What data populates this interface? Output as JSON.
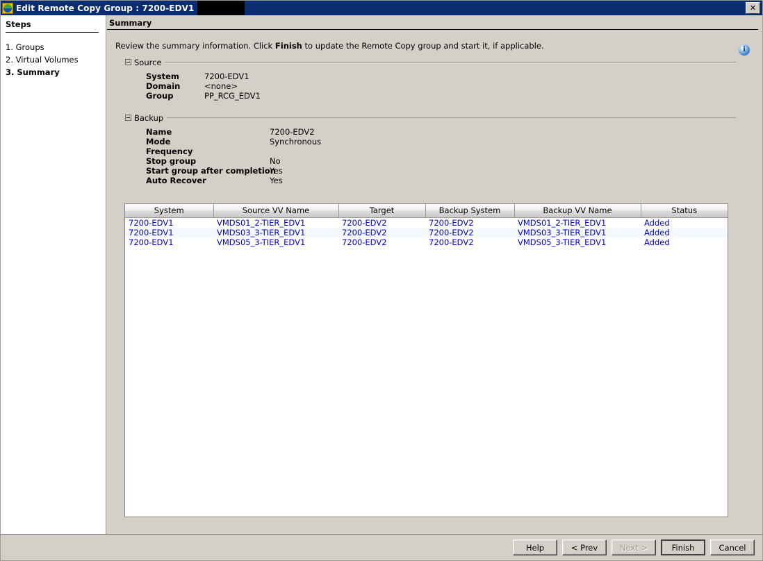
{
  "window": {
    "title": "Edit Remote Copy Group : 7200-EDV1",
    "icon": "app-globe-icon",
    "close_label": "✕",
    "redacted": true
  },
  "sidebar": {
    "title": "Steps",
    "items": [
      {
        "label": "1. Groups",
        "active": false
      },
      {
        "label": "2. Virtual Volumes",
        "active": false
      },
      {
        "label": "3. Summary",
        "active": true
      }
    ]
  },
  "main": {
    "title": "Summary",
    "description_prefix": "Review the summary information. Click ",
    "description_bold": "Finish",
    "description_suffix": " to update the Remote Copy group and start it, if applicable.",
    "info_icon_glyph": "i"
  },
  "source_group": {
    "label": "Source",
    "rows": [
      {
        "key": "System",
        "value": "7200-EDV1"
      },
      {
        "key": "Domain",
        "value": "<none>"
      },
      {
        "key": "Group",
        "value": "PP_RCG_EDV1"
      }
    ]
  },
  "backup_group": {
    "label": "Backup",
    "rows": [
      {
        "key": "Name",
        "value": "7200-EDV2"
      },
      {
        "key": "Mode",
        "value": "Synchronous"
      },
      {
        "key": "Frequency",
        "value": ""
      },
      {
        "key": "Stop group",
        "value": "No"
      },
      {
        "key": "Start group after completion",
        "value": "Yes"
      },
      {
        "key": "Auto Recover",
        "value": "Yes"
      }
    ]
  },
  "table": {
    "columns": [
      "System",
      "Source VV Name",
      "Target",
      "Backup System",
      "Backup VV Name",
      "Status"
    ],
    "rows": [
      [
        "7200-EDV1",
        "VMDS01_2-TIER_EDV1",
        "7200-EDV2",
        "7200-EDV2",
        "VMDS01_2-TIER_EDV1",
        "Added"
      ],
      [
        "7200-EDV1",
        "VMDS03_3-TIER_EDV1",
        "7200-EDV2",
        "7200-EDV2",
        "VMDS03_3-TIER_EDV1",
        "Added"
      ],
      [
        "7200-EDV1",
        "VMDS05_3-TIER_EDV1",
        "7200-EDV2",
        "7200-EDV2",
        "VMDS05_3-TIER_EDV1",
        "Added"
      ]
    ]
  },
  "buttons": [
    {
      "label": "Help",
      "disabled": false,
      "default": false
    },
    {
      "label": "< Prev",
      "disabled": false,
      "default": false
    },
    {
      "label": "Next >",
      "disabled": true,
      "default": false
    },
    {
      "label": "Finish",
      "disabled": false,
      "default": true
    },
    {
      "label": "Cancel",
      "disabled": false,
      "default": false
    }
  ],
  "colors": {
    "titlebar": "#0a2d72",
    "window_face": "#d4d0c8",
    "panel": "#ffffff",
    "link_text": "#0000cc",
    "alt_row": "#f5f8ff"
  }
}
